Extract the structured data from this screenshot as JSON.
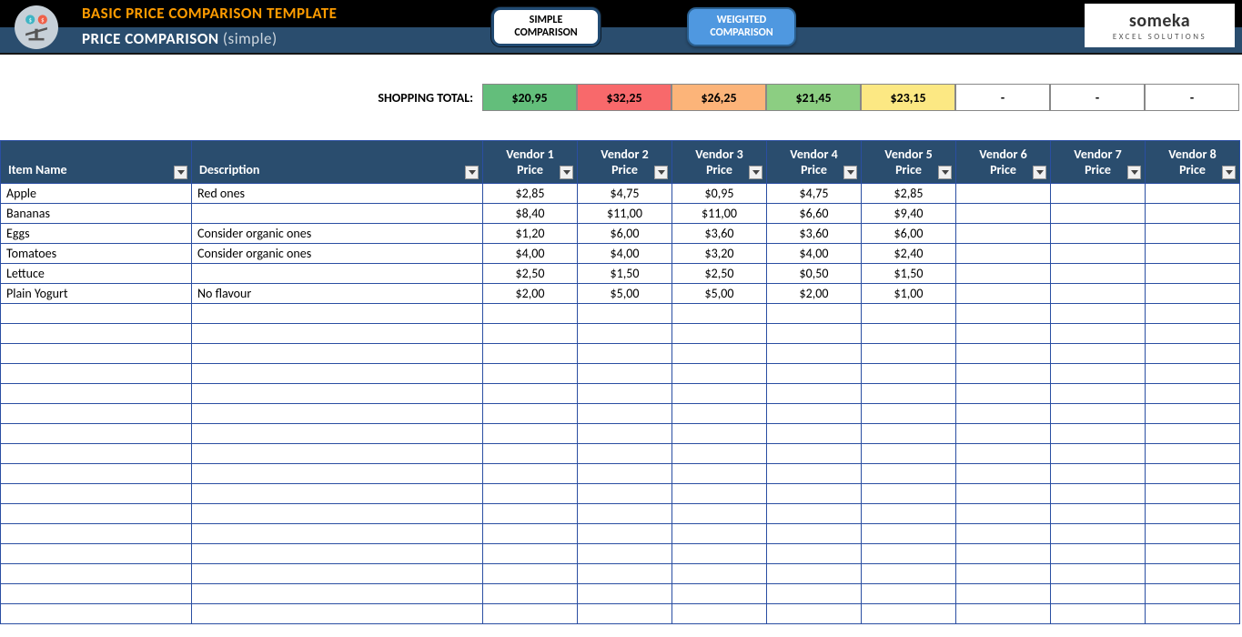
{
  "header": {
    "title1": "BASIC PRICE COMPARISON TEMPLATE",
    "title2_bold": "PRICE COMPARISON",
    "title2_suffix": "(simple)",
    "btn_simple_l1": "SIMPLE",
    "btn_simple_l2": "COMPARISON",
    "btn_weighted_l1": "WEIGHTED",
    "btn_weighted_l2": "COMPARISON",
    "logo_brand": "someka",
    "logo_sub": "EXCEL SOLUTIONS"
  },
  "totals": {
    "label": "SHOPPING TOTAL:",
    "cells": [
      {
        "value": "$20,95",
        "cls": "g"
      },
      {
        "value": "$32,25",
        "cls": "r"
      },
      {
        "value": "$26,25",
        "cls": "o"
      },
      {
        "value": "$21,45",
        "cls": "lg"
      },
      {
        "value": "$23,15",
        "cls": "y"
      },
      {
        "value": "-",
        "cls": "blank"
      },
      {
        "value": "-",
        "cls": "blank"
      },
      {
        "value": "-",
        "cls": "blank"
      }
    ]
  },
  "table": {
    "headers": {
      "item": "Item Name",
      "desc": "Description",
      "vendors": [
        {
          "l1": "Vendor 1",
          "l2": "Price"
        },
        {
          "l1": "Vendor 2",
          "l2": "Price"
        },
        {
          "l1": "Vendor 3",
          "l2": "Price"
        },
        {
          "l1": "Vendor 4",
          "l2": "Price"
        },
        {
          "l1": "Vendor 5",
          "l2": "Price"
        },
        {
          "l1": "Vendor 6",
          "l2": "Price"
        },
        {
          "l1": "Vendor 7",
          "l2": "Price"
        },
        {
          "l1": "Vendor 8",
          "l2": "Price"
        }
      ]
    },
    "rows": [
      {
        "item": "Apple",
        "desc": "Red ones",
        "prices": [
          "$2,85",
          "$4,75",
          "$0,95",
          "$4,75",
          "$2,85",
          "",
          "",
          ""
        ]
      },
      {
        "item": "Bananas",
        "desc": "",
        "prices": [
          "$8,40",
          "$11,00",
          "$11,00",
          "$6,60",
          "$9,40",
          "",
          "",
          ""
        ]
      },
      {
        "item": "Eggs",
        "desc": "Consider organic ones",
        "prices": [
          "$1,20",
          "$6,00",
          "$3,60",
          "$3,60",
          "$6,00",
          "",
          "",
          ""
        ]
      },
      {
        "item": "Tomatoes",
        "desc": "Consider organic ones",
        "prices": [
          "$4,00",
          "$4,00",
          "$3,20",
          "$4,00",
          "$2,40",
          "",
          "",
          ""
        ]
      },
      {
        "item": "Lettuce",
        "desc": "",
        "prices": [
          "$2,50",
          "$1,50",
          "$2,50",
          "$0,50",
          "$1,50",
          "",
          "",
          ""
        ]
      },
      {
        "item": "Plain Yogurt",
        "desc": "No flavour",
        "prices": [
          "$2,00",
          "$5,00",
          "$5,00",
          "$2,00",
          "$1,00",
          "",
          "",
          ""
        ]
      }
    ],
    "empty_rows": 16
  }
}
